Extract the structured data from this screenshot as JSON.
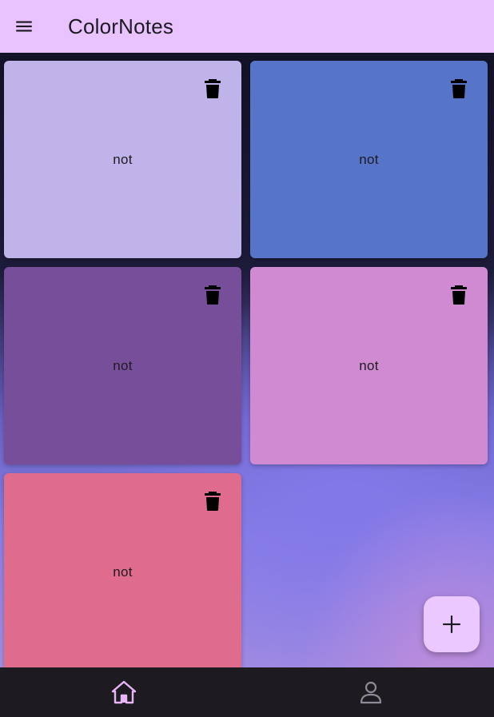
{
  "app": {
    "title": "ColorNotes",
    "menu_icon": "menu-icon"
  },
  "notes": [
    {
      "text": "not",
      "color": "#c0b3ea",
      "action_icon": "trash-icon"
    },
    {
      "text": "not",
      "color": "#5675c8",
      "action_icon": "trash-icon"
    },
    {
      "text": "not",
      "color": "#774e99",
      "action_icon": "trash-icon"
    },
    {
      "text": "not",
      "color": "#d08ad1",
      "action_icon": "trash-icon"
    },
    {
      "text": "not",
      "color": "#df6c8c",
      "action_icon": "trash-icon"
    }
  ],
  "fab": {
    "icon": "plus-icon",
    "color": "#ebc8ff"
  },
  "bottom_nav": {
    "items": [
      {
        "icon": "home-icon",
        "active": true,
        "color": "#e8b6f8"
      },
      {
        "icon": "person-icon",
        "active": false,
        "color": "#8f8a97"
      }
    ]
  },
  "colors": {
    "appbar": "#e8c3ff",
    "nav_background": "#1d1b20"
  }
}
